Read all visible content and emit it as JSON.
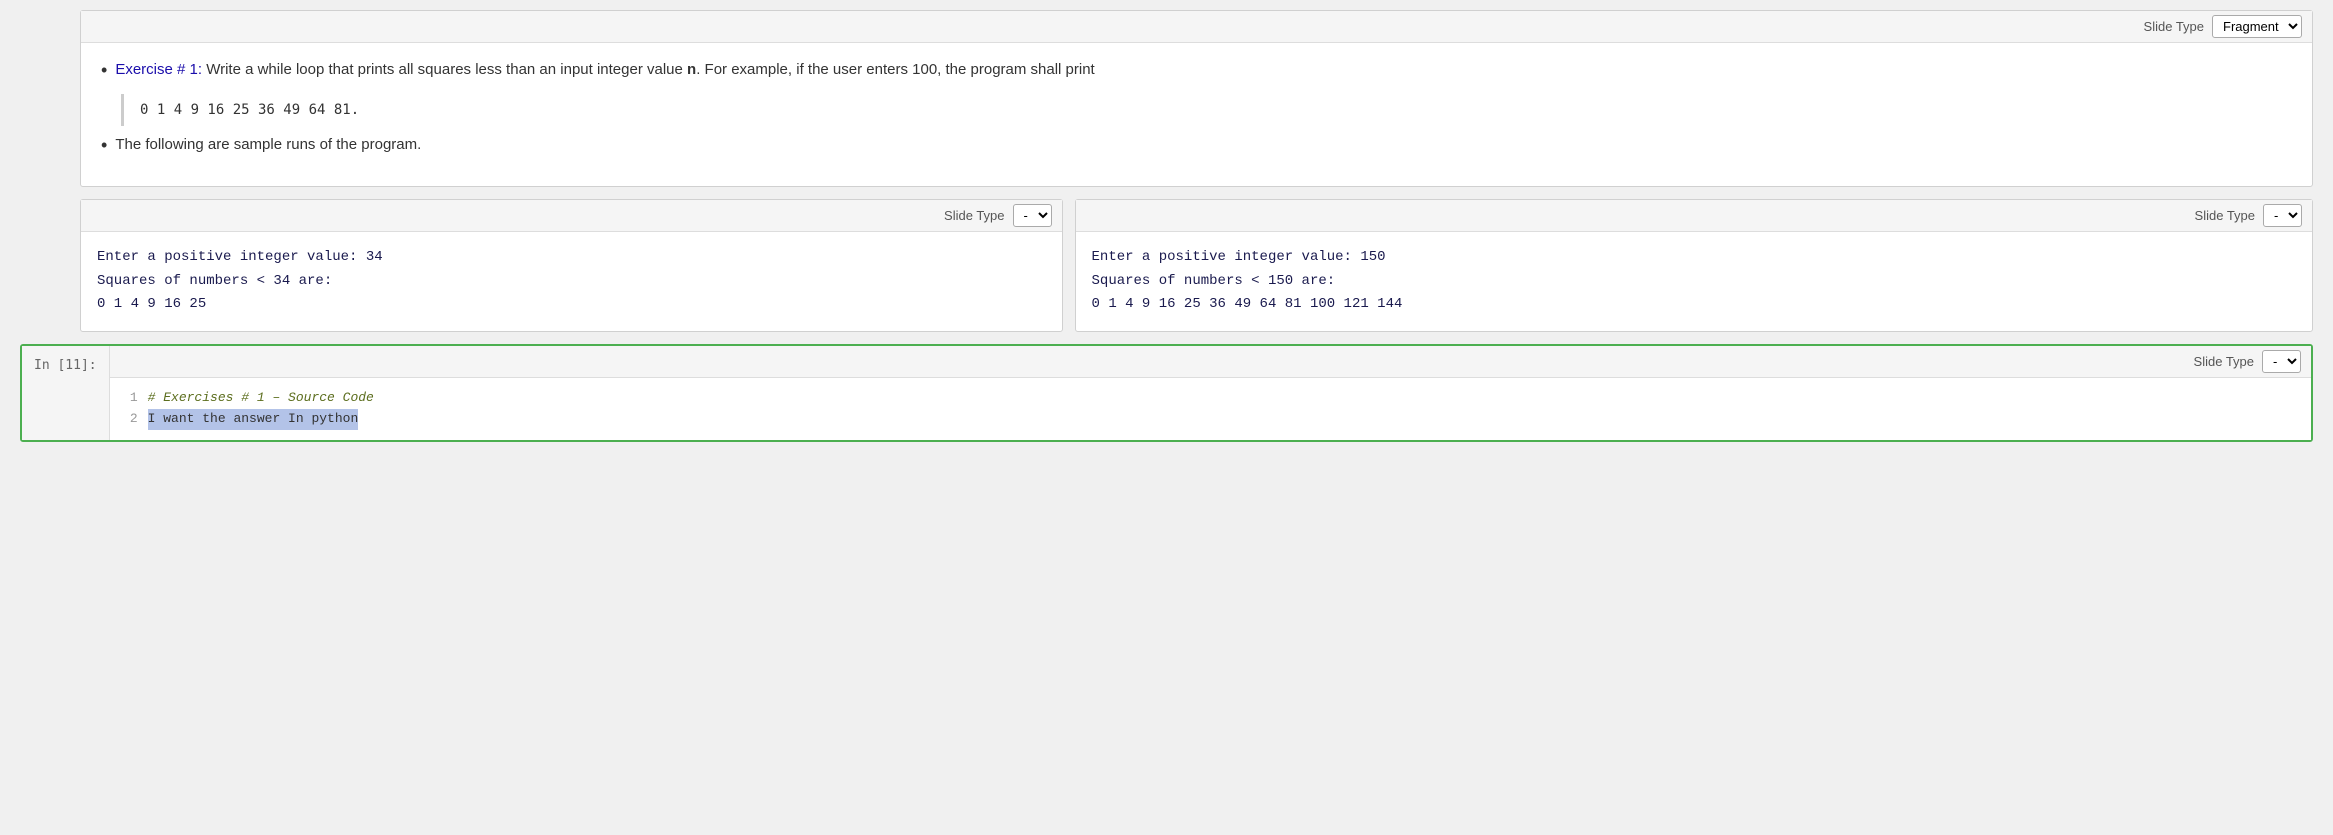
{
  "slideTypeLabel": "Slide Type",
  "fragmentCell": {
    "slideType": "Fragment",
    "bullets": [
      {
        "exerciseLink": "Exercise # 1:",
        "exerciseLinkHref": "#",
        "text": " Write a while loop that prints all squares less than an input integer value ",
        "bold": "n",
        "textAfter": ". For example, if the user enters 100, the program shall print"
      },
      {
        "text": "The following are sample runs of the program."
      }
    ],
    "codeQuote": "0 1 4 9 16 25 36 49 64 81."
  },
  "sampleCells": [
    {
      "slideType": "-",
      "lines": [
        "Enter a positive integer value: 34",
        "Squares of numbers < 34 are:",
        "0    1    4    9    16   25"
      ]
    },
    {
      "slideType": "-",
      "lines": [
        "Enter a positive integer value: 150",
        "Squares of numbers < 150 are:",
        "0   1   4   9   16  25  36  49  64  81  100 121 144"
      ]
    }
  ],
  "codeCell": {
    "prompt": "In [11]:",
    "slideType": "-",
    "lines": [
      {
        "num": "1",
        "type": "comment",
        "text": "# Exercises # 1 – Source Code"
      },
      {
        "num": "2",
        "type": "highlight",
        "text": "I want the answer In python"
      }
    ]
  }
}
